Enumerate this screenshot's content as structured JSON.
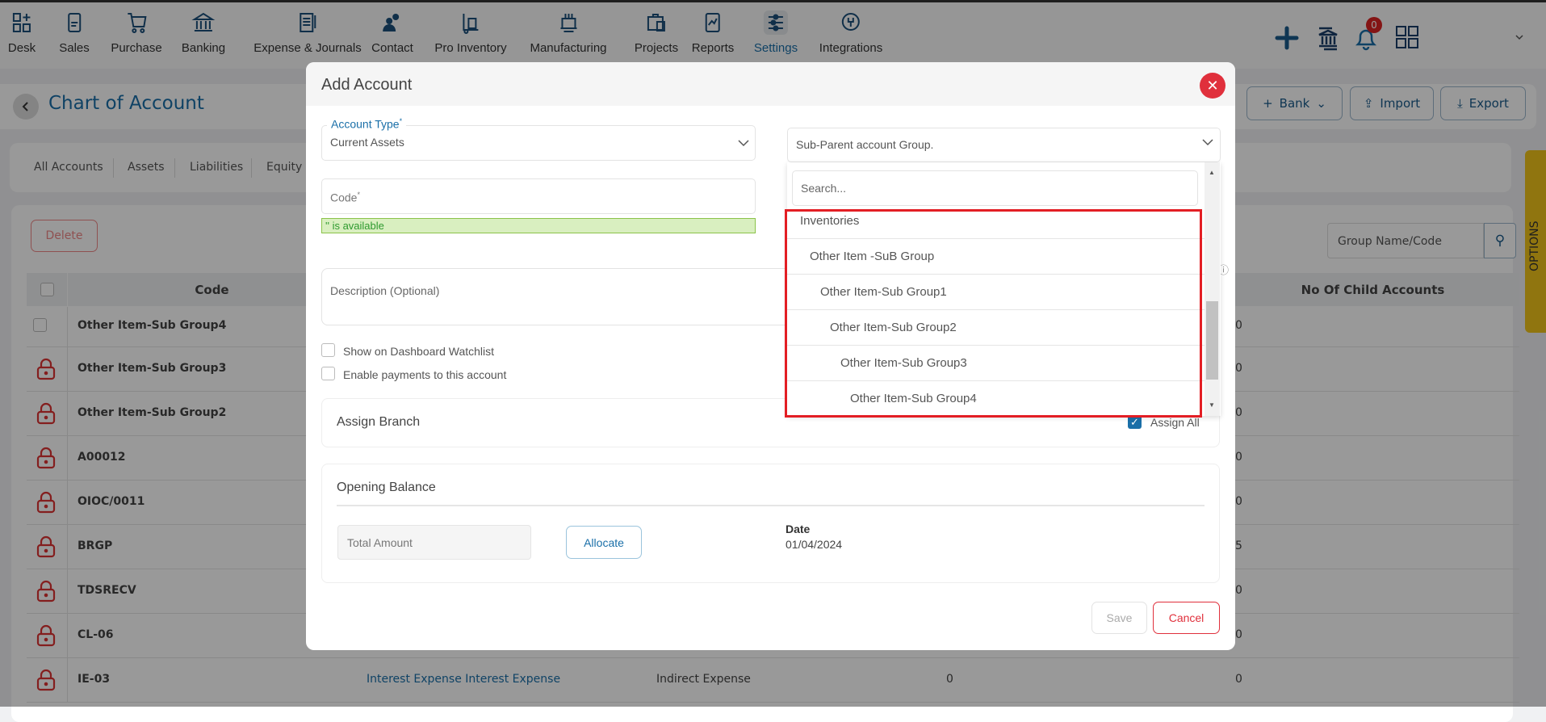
{
  "nav": {
    "items": [
      {
        "label": "Desk",
        "icon": "desk-grid-icon"
      },
      {
        "label": "Sales",
        "icon": "receipt-icon"
      },
      {
        "label": "Purchase",
        "icon": "cart-icon"
      },
      {
        "label": "Banking",
        "icon": "bank-icon"
      },
      {
        "label": "Expense & Journals",
        "icon": "journal-icon"
      },
      {
        "label": "Contact",
        "icon": "contacts-icon"
      },
      {
        "label": "Pro Inventory",
        "icon": "inventory-icon"
      },
      {
        "label": "Manufacturing",
        "icon": "manufacturing-icon"
      },
      {
        "label": "Projects",
        "icon": "projects-icon"
      },
      {
        "label": "Reports",
        "icon": "reports-icon"
      },
      {
        "label": "Settings",
        "icon": "settings-sliders-icon",
        "active": true
      },
      {
        "label": "Integrations",
        "icon": "integrations-icon"
      }
    ],
    "notification_count": "0"
  },
  "header": {
    "title": "Chart of Account",
    "bank_label": "Bank",
    "import_label": "Import",
    "export_label": "Export"
  },
  "tabs": [
    "All Accounts",
    "Assets",
    "Liabilities",
    "Equity"
  ],
  "toolbar": {
    "delete_label": "Delete",
    "search_placeholder": "Group Name/Code"
  },
  "options_label": "OPTIONS",
  "table": {
    "headers": {
      "code": "Code",
      "children": "No Of Child Accounts"
    },
    "rows": [
      {
        "code": "Other Item-Sub Group4",
        "children": "0",
        "locked": false
      },
      {
        "code": "Other Item-Sub Group3",
        "children": "0",
        "locked": true
      },
      {
        "code": "Other Item-Sub Group2",
        "children": "0",
        "locked": true
      },
      {
        "code": "A00012",
        "children": "0",
        "locked": true
      },
      {
        "code": "OIOC/0011",
        "children": "0",
        "locked": true
      },
      {
        "code": "BRGP",
        "children": "5",
        "locked": true
      },
      {
        "code": "TDSRECV",
        "children": "0",
        "locked": true
      },
      {
        "code": "CL-06",
        "children": "0",
        "locked": true
      },
      {
        "code": "IE-03",
        "name": "Interest Expense Interest Expense",
        "type": "Indirect Expense",
        "col4": "0",
        "children": "0",
        "locked": true
      }
    ]
  },
  "modal": {
    "title": "Add Account",
    "account_type_label": "Account Type",
    "account_type_value": "Current Assets",
    "code_placeholder": "Code",
    "required_mark": "*",
    "availability": "'' is available",
    "description_placeholder": "Description (Optional)",
    "show_dashboard": "Show on Dashboard Watchlist",
    "enable_payments": "Enable payments to this account",
    "assign_branch": "Assign Branch",
    "assign_all": "Assign All",
    "opening_balance": "Opening Balance",
    "total_amount_placeholder": "Total Amount",
    "allocate": "Allocate",
    "date_label": "Date",
    "date_value": "01/04/2024",
    "save": "Save",
    "cancel": "Cancel",
    "sub_parent_placeholder": "Sub-Parent account Group.",
    "search_placeholder": "Search...",
    "options": [
      "Inventories",
      "Other Item -SuB Group",
      "Other Item-Sub Group1",
      "Other Item-Sub Group2",
      "Other Item-Sub Group3",
      "Other Item-Sub Group4"
    ]
  },
  "colors": {
    "accent": "#1a6fa8",
    "danger": "#e0303c",
    "highlight": "#e31e24",
    "success_bg": "#d9efc0",
    "options_tab": "#f0c419"
  }
}
